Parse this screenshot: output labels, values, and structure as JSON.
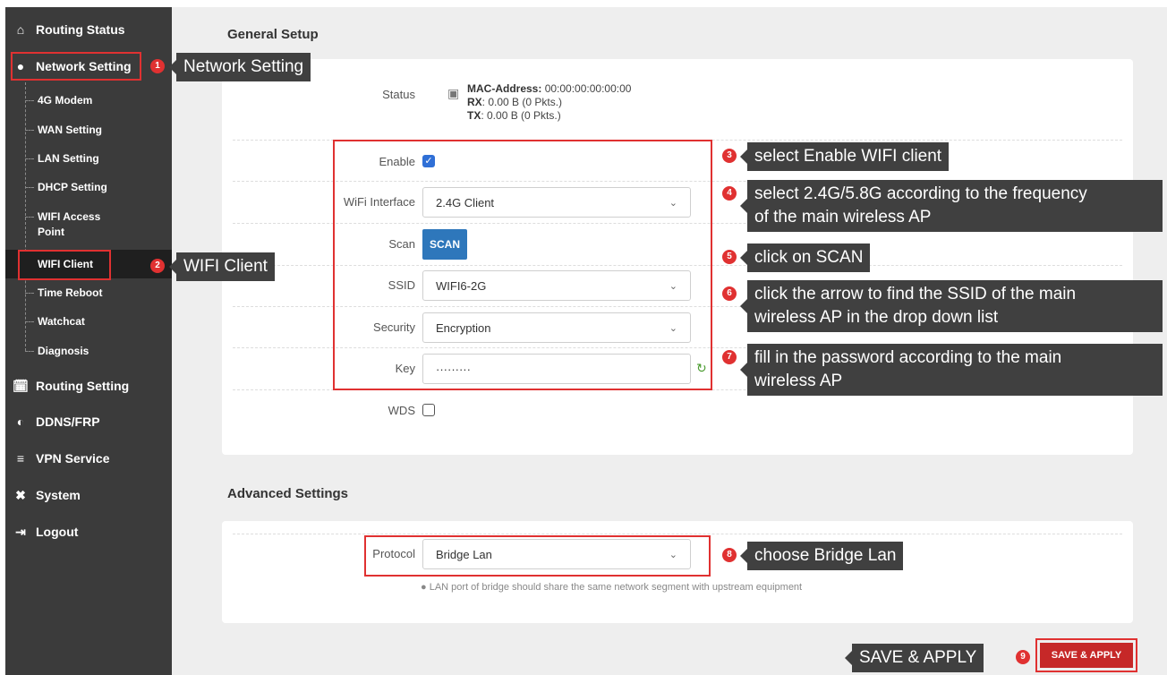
{
  "sidebar": {
    "top_items": [
      {
        "label": "Routing Status",
        "icon": "home-icon"
      },
      {
        "label": "Network Setting",
        "icon": "globe-icon"
      },
      {
        "label": "Routing Setting",
        "icon": "calendar-icon"
      },
      {
        "label": "DDNS/FRP",
        "icon": "gauge-icon"
      },
      {
        "label": "VPN Service",
        "icon": "list-icon"
      },
      {
        "label": "System",
        "icon": "tools-icon"
      },
      {
        "label": "Logout",
        "icon": "logout-icon"
      }
    ],
    "sub_items": [
      "4G Modem",
      "WAN Setting",
      "LAN Setting",
      "DHCP Setting",
      "WIFI Access Point",
      "WIFI Client",
      "Time Reboot",
      "Watchcat",
      "Diagnosis"
    ],
    "active_sub": "WIFI Client"
  },
  "general": {
    "title": "General Setup",
    "status_label": "Status",
    "mac_label": "MAC-Address:",
    "mac_value": "00:00:00:00:00:00",
    "rx_label": "RX",
    "rx_value": ": 0.00 B (0 Pkts.)",
    "tx_label": "TX",
    "tx_value": ": 0.00 B (0 Pkts.)",
    "enable_label": "Enable",
    "enable_checked": true,
    "wifi_interface_label": "WiFi Interface",
    "wifi_interface_value": "2.4G Client",
    "scan_label": "Scan",
    "scan_button": "SCAN",
    "ssid_label": "SSID",
    "ssid_value": "WIFI6-2G",
    "security_label": "Security",
    "security_value": "Encryption",
    "key_label": "Key",
    "key_value": "·········",
    "wds_label": "WDS",
    "wds_checked": false
  },
  "advanced": {
    "title": "Advanced Settings",
    "protocol_label": "Protocol",
    "protocol_value": "Bridge Lan",
    "hint": "LAN port of bridge should share the same network segment with upstream equipment"
  },
  "save_button": "SAVE & APPLY",
  "annotations": {
    "n1": "1",
    "n2": "2",
    "n3": "3",
    "n4": "4",
    "n5": "5",
    "n6": "6",
    "n7": "7",
    "n8": "8",
    "n9": "9",
    "c1": "Network Setting",
    "c2": "WIFI Client",
    "c3": "select Enable WIFI client",
    "c4_line1": "select 2.4G/5.8G according to the frequency",
    "c4_line2": "of the main wireless AP",
    "c5": "click on SCAN",
    "c6_line1": "click the arrow to find the SSID of the main",
    "c6_line2": "wireless  AP in the drop down list",
    "c7_line1": "fill in the password according to the main",
    "c7_line2": "wireless AP",
    "c8": "choose Bridge Lan",
    "c9": "SAVE & APPLY"
  },
  "colors": {
    "sidebar": "#3b3b3b",
    "accent_red": "#e03131",
    "scan_blue": "#2e77bb",
    "save_red": "#c62828"
  }
}
